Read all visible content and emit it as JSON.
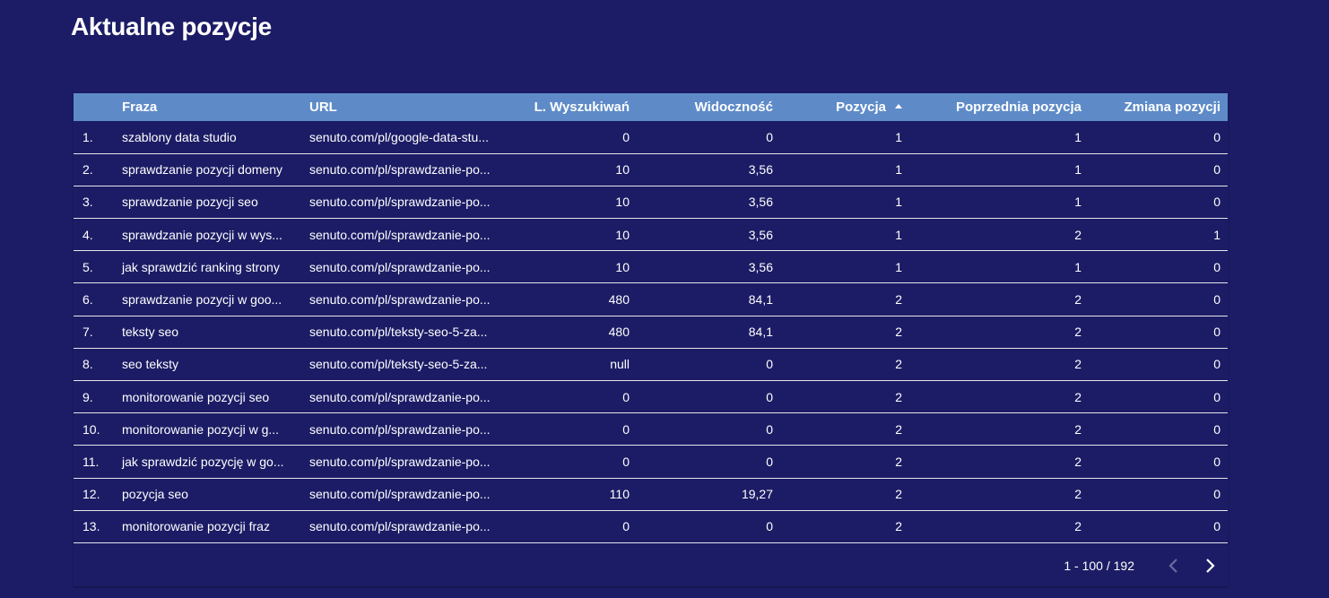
{
  "title": "Aktualne pozycje",
  "columns": [
    {
      "label": "",
      "align": "left"
    },
    {
      "label": "Fraza",
      "align": "left"
    },
    {
      "label": "URL",
      "align": "left"
    },
    {
      "label": "L. Wyszukiwań",
      "align": "right"
    },
    {
      "label": "Widoczność",
      "align": "right"
    },
    {
      "label": "Pozycja",
      "align": "right",
      "sorted": "asc"
    },
    {
      "label": "Poprzednia pozycja",
      "align": "right"
    },
    {
      "label": "Zmiana pozycji",
      "align": "right"
    }
  ],
  "rows": [
    [
      "1.",
      "szablony data studio",
      "senuto.com/pl/google-data-stu...",
      "0",
      "0",
      "1",
      "1",
      "0"
    ],
    [
      "2.",
      "sprawdzanie pozycji domeny",
      "senuto.com/pl/sprawdzanie-po...",
      "10",
      "3,56",
      "1",
      "1",
      "0"
    ],
    [
      "3.",
      "sprawdzanie pozycji seo",
      "senuto.com/pl/sprawdzanie-po...",
      "10",
      "3,56",
      "1",
      "1",
      "0"
    ],
    [
      "4.",
      "sprawdzanie pozycji w wys...",
      "senuto.com/pl/sprawdzanie-po...",
      "10",
      "3,56",
      "1",
      "2",
      "1"
    ],
    [
      "5.",
      "jak sprawdzić ranking strony",
      "senuto.com/pl/sprawdzanie-po...",
      "10",
      "3,56",
      "1",
      "1",
      "0"
    ],
    [
      "6.",
      "sprawdzanie pozycji w goo...",
      "senuto.com/pl/sprawdzanie-po...",
      "480",
      "84,1",
      "2",
      "2",
      "0"
    ],
    [
      "7.",
      "teksty seo",
      "senuto.com/pl/teksty-seo-5-za...",
      "480",
      "84,1",
      "2",
      "2",
      "0"
    ],
    [
      "8.",
      "seo teksty",
      "senuto.com/pl/teksty-seo-5-za...",
      "null",
      "0",
      "2",
      "2",
      "0"
    ],
    [
      "9.",
      "monitorowanie pozycji seo",
      "senuto.com/pl/sprawdzanie-po...",
      "0",
      "0",
      "2",
      "2",
      "0"
    ],
    [
      "10.",
      "monitorowanie pozycji w g...",
      "senuto.com/pl/sprawdzanie-po...",
      "0",
      "0",
      "2",
      "2",
      "0"
    ],
    [
      "11.",
      "jak sprawdzić pozycję w go...",
      "senuto.com/pl/sprawdzanie-po...",
      "0",
      "0",
      "2",
      "2",
      "0"
    ],
    [
      "12.",
      "pozycja seo",
      "senuto.com/pl/sprawdzanie-po...",
      "110",
      "19,27",
      "2",
      "2",
      "0"
    ],
    [
      "13.",
      "monitorowanie pozycji fraz",
      "senuto.com/pl/sprawdzanie-po...",
      "0",
      "0",
      "2",
      "2",
      "0"
    ]
  ],
  "pagination": {
    "range": "1 - 100 / 192",
    "prev_icon": "chevron-left-icon",
    "next_icon": "chevron-right-icon"
  },
  "colors": {
    "background": "#1c1c66",
    "header": "#5e8bc8",
    "row_divider": "#e6e6ee",
    "disabled": "#6a6aa0"
  }
}
